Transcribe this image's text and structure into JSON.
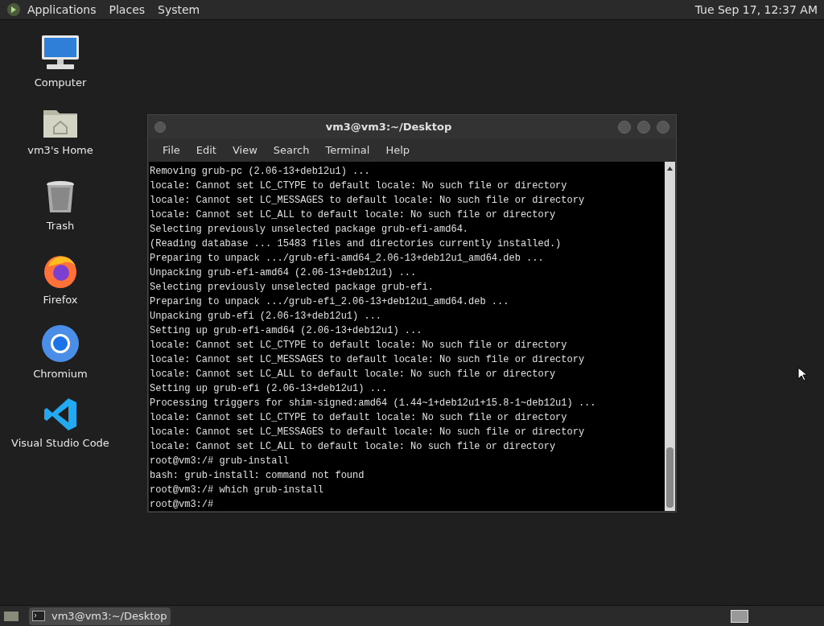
{
  "top_panel": {
    "menus": [
      "Applications",
      "Places",
      "System"
    ],
    "clock": "Tue Sep 17, 12:37 AM"
  },
  "desktop_icons": [
    {
      "kind": "computer",
      "label": "Computer"
    },
    {
      "kind": "home",
      "label": "vm3's Home"
    },
    {
      "kind": "trash",
      "label": "Trash"
    },
    {
      "kind": "firefox",
      "label": "Firefox"
    },
    {
      "kind": "chromium",
      "label": "Chromium"
    },
    {
      "kind": "vscode",
      "label": "Visual Studio Code"
    }
  ],
  "terminal": {
    "title": "vm3@vm3:~/Desktop",
    "menu": [
      "File",
      "Edit",
      "View",
      "Search",
      "Terminal",
      "Help"
    ],
    "lines": [
      "Removing grub-pc (2.06-13+deb12u1) ...",
      "locale: Cannot set LC_CTYPE to default locale: No such file or directory",
      "locale: Cannot set LC_MESSAGES to default locale: No such file or directory",
      "locale: Cannot set LC_ALL to default locale: No such file or directory",
      "Selecting previously unselected package grub-efi-amd64.",
      "(Reading database ... 15483 files and directories currently installed.)",
      "Preparing to unpack .../grub-efi-amd64_2.06-13+deb12u1_amd64.deb ...",
      "Unpacking grub-efi-amd64 (2.06-13+deb12u1) ...",
      "Selecting previously unselected package grub-efi.",
      "Preparing to unpack .../grub-efi_2.06-13+deb12u1_amd64.deb ...",
      "Unpacking grub-efi (2.06-13+deb12u1) ...",
      "Setting up grub-efi-amd64 (2.06-13+deb12u1) ...",
      "locale: Cannot set LC_CTYPE to default locale: No such file or directory",
      "locale: Cannot set LC_MESSAGES to default locale: No such file or directory",
      "locale: Cannot set LC_ALL to default locale: No such file or directory",
      "Setting up grub-efi (2.06-13+deb12u1) ...",
      "Processing triggers for shim-signed:amd64 (1.44~1+deb12u1+15.8-1~deb12u1) ...",
      "locale: Cannot set LC_CTYPE to default locale: No such file or directory",
      "locale: Cannot set LC_MESSAGES to default locale: No such file or directory",
      "locale: Cannot set LC_ALL to default locale: No such file or directory",
      "root@vm3:/# grub-install",
      "bash: grub-install: command not found",
      "root@vm3:/# which grub-install",
      "root@vm3:/#"
    ]
  },
  "taskbar": {
    "tasks": [
      {
        "label": "vm3@vm3:~/Desktop",
        "selected": true
      }
    ]
  }
}
